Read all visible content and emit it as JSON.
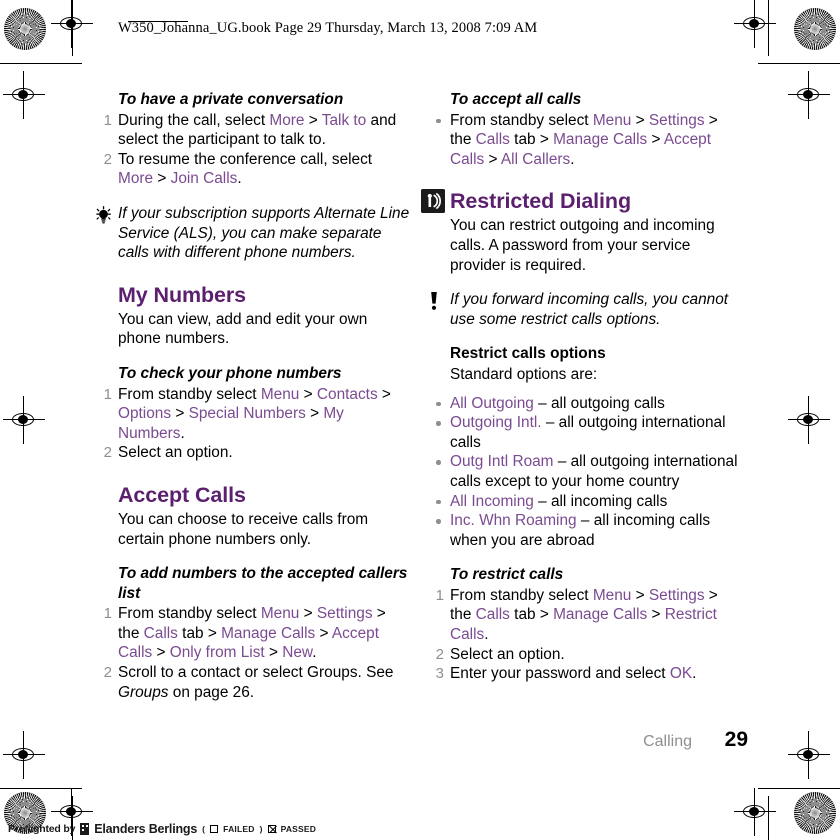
{
  "header": {
    "slug": "W350_Johanna_UG.book  Page 29  Thursday, March 13, 2008  7:09 AM"
  },
  "colors": {
    "heading_purple": "#5b1f6e",
    "link_purple": "#7a4b90",
    "marker_gray": "#8f8f8f"
  },
  "left_column": {
    "private_conversation": {
      "subhead": "To have a private conversation",
      "steps": [
        {
          "num": "1",
          "parts": [
            {
              "t": "During the call, select ",
              "s": "plain"
            },
            {
              "t": "More",
              "s": "link"
            },
            {
              "t": " > ",
              "s": "sep"
            },
            {
              "t": "Talk to",
              "s": "link"
            },
            {
              "t": " and select the participant to talk to.",
              "s": "plain"
            }
          ]
        },
        {
          "num": "2",
          "parts": [
            {
              "t": "To resume the conference call, select ",
              "s": "plain"
            },
            {
              "t": "More",
              "s": "link"
            },
            {
              "t": " > ",
              "s": "sep"
            },
            {
              "t": "Join Calls",
              "s": "link"
            },
            {
              "t": ".",
              "s": "plain"
            }
          ]
        }
      ]
    },
    "tip_note": {
      "icon": "lightbulb-icon",
      "text": "If your subscription supports Alternate Line Service (ALS), you can make separate calls with different phone numbers."
    },
    "my_numbers": {
      "heading": "My Numbers",
      "body": "You can view, add and edit your own phone numbers.",
      "subhead": "To check your phone numbers",
      "steps": [
        {
          "num": "1",
          "parts": [
            {
              "t": "From standby select ",
              "s": "plain"
            },
            {
              "t": "Menu",
              "s": "link"
            },
            {
              "t": " > ",
              "s": "sep"
            },
            {
              "t": "Contacts",
              "s": "link"
            },
            {
              "t": " > ",
              "s": "sep"
            },
            {
              "t": "Options",
              "s": "link"
            },
            {
              "t": " > ",
              "s": "sep"
            },
            {
              "t": "Special Numbers",
              "s": "link"
            },
            {
              "t": " > ",
              "s": "sep"
            },
            {
              "t": "My Numbers",
              "s": "link"
            },
            {
              "t": ".",
              "s": "plain"
            }
          ]
        },
        {
          "num": "2",
          "parts": [
            {
              "t": "Select an option.",
              "s": "plain"
            }
          ]
        }
      ]
    },
    "accept_calls": {
      "heading": "Accept Calls",
      "body": "You can choose to receive calls from certain phone numbers only.",
      "subhead": "To add numbers to the accepted callers list",
      "steps": [
        {
          "num": "1",
          "parts": [
            {
              "t": "From standby select ",
              "s": "plain"
            },
            {
              "t": "Menu",
              "s": "link"
            },
            {
              "t": " > ",
              "s": "sep"
            },
            {
              "t": "Settings",
              "s": "link"
            },
            {
              "t": " > the ",
              "s": "sep"
            },
            {
              "t": "Calls",
              "s": "link"
            },
            {
              "t": " tab > ",
              "s": "sep"
            },
            {
              "t": "Manage Calls",
              "s": "link"
            },
            {
              "t": " > ",
              "s": "sep"
            },
            {
              "t": "Accept Calls",
              "s": "link"
            },
            {
              "t": " > ",
              "s": "sep"
            },
            {
              "t": "Only from List",
              "s": "link"
            },
            {
              "t": " > ",
              "s": "sep"
            },
            {
              "t": "New",
              "s": "link"
            },
            {
              "t": ".",
              "s": "plain"
            }
          ]
        },
        {
          "num": "2",
          "parts": [
            {
              "t": "Scroll to a contact or select Groups. See ",
              "s": "plain"
            },
            {
              "t": "Groups",
              "s": "ital"
            },
            {
              "t": " on page 26.",
              "s": "plain"
            }
          ]
        }
      ]
    }
  },
  "right_column": {
    "accept_all_calls": {
      "subhead": "To accept all calls",
      "items": [
        {
          "parts": [
            {
              "t": "From standby select ",
              "s": "plain"
            },
            {
              "t": "Menu",
              "s": "link"
            },
            {
              "t": " > ",
              "s": "sep"
            },
            {
              "t": "Settings",
              "s": "link"
            },
            {
              "t": " > the ",
              "s": "sep"
            },
            {
              "t": "Calls",
              "s": "link"
            },
            {
              "t": " tab > ",
              "s": "sep"
            },
            {
              "t": "Manage Calls",
              "s": "link"
            },
            {
              "t": " > ",
              "s": "sep"
            },
            {
              "t": "Accept Calls",
              "s": "link"
            },
            {
              "t": " > ",
              "s": "sep"
            },
            {
              "t": "All Callers",
              "s": "link"
            },
            {
              "t": ".",
              "s": "plain"
            }
          ]
        }
      ]
    },
    "restricted_dialing": {
      "icon": "restricted-dialing-icon",
      "heading": "Restricted Dialing",
      "body": "You can restrict outgoing and incoming calls. A password from your service provider is required."
    },
    "warning_note": {
      "icon": "exclamation-icon",
      "text": "If you forward incoming calls, you cannot use some restrict calls options."
    },
    "restrict_options": {
      "subhead": "Restrict calls options",
      "lead": "Standard options are:",
      "bullets": [
        {
          "parts": [
            {
              "t": "All Outgoing",
              "s": "link"
            },
            {
              "t": " – all outgoing calls",
              "s": "plain"
            }
          ]
        },
        {
          "parts": [
            {
              "t": "Outgoing Intl.",
              "s": "link"
            },
            {
              "t": " – all outgoing international calls",
              "s": "plain"
            }
          ]
        },
        {
          "parts": [
            {
              "t": "Outg Intl Roam",
              "s": "link"
            },
            {
              "t": " – all outgoing international calls except to your home country",
              "s": "plain"
            }
          ]
        },
        {
          "parts": [
            {
              "t": "All Incoming",
              "s": "link"
            },
            {
              "t": " – all incoming calls",
              "s": "plain"
            }
          ]
        },
        {
          "parts": [
            {
              "t": "Inc. Whn Roaming",
              "s": "link"
            },
            {
              "t": " – all incoming calls when you are abroad",
              "s": "plain"
            }
          ]
        }
      ]
    },
    "to_restrict_calls": {
      "subhead": "To restrict calls",
      "steps": [
        {
          "num": "1",
          "parts": [
            {
              "t": "From standby select ",
              "s": "plain"
            },
            {
              "t": "Menu",
              "s": "link"
            },
            {
              "t": " > ",
              "s": "sep"
            },
            {
              "t": "Settings",
              "s": "link"
            },
            {
              "t": " > the ",
              "s": "sep"
            },
            {
              "t": "Calls",
              "s": "link"
            },
            {
              "t": " tab > ",
              "s": "sep"
            },
            {
              "t": "Manage Calls",
              "s": "link"
            },
            {
              "t": " > ",
              "s": "sep"
            },
            {
              "t": "Restrict Calls",
              "s": "link"
            },
            {
              "t": ".",
              "s": "plain"
            }
          ]
        },
        {
          "num": "2",
          "parts": [
            {
              "t": "Select an option.",
              "s": "plain"
            }
          ]
        },
        {
          "num": "3",
          "parts": [
            {
              "t": "Enter your password and select ",
              "s": "plain"
            },
            {
              "t": "OK",
              "s": "link"
            },
            {
              "t": ".",
              "s": "plain"
            }
          ]
        }
      ]
    }
  },
  "footer": {
    "chapter": "Calling",
    "page_number": "29"
  },
  "preflight": {
    "label": "Preflighted by",
    "brand": "Elanders Berlings",
    "open_paren": "(",
    "failed_label": "FAILED",
    "close_paren": ")",
    "passed_label": "PASSED"
  }
}
